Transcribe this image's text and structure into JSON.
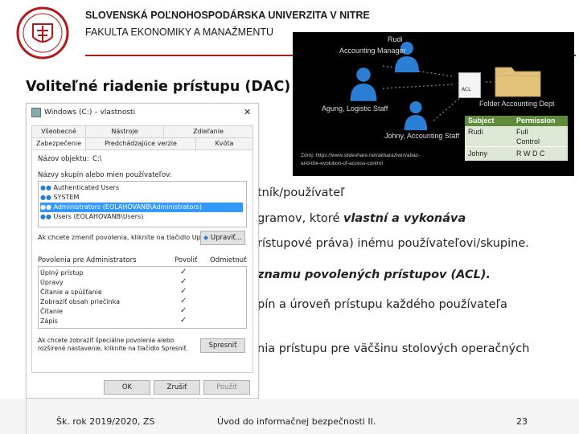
{
  "header": {
    "university": "SLOVENSKÁ POĽNOHOSPODÁRSKA UNIVERZITA V NITRE",
    "faculty": "FAKULTA EKONOMIKY A MANAŽMENTU"
  },
  "slide": {
    "title": "Voliteľné riadenie prístupu (DAC)",
    "lines": [
      {
        "text": "tník/používateľ"
      },
      {
        "text_a": "gramov, ktoré ",
        "text_b": "vlastní a vykonáva"
      },
      {
        "text": "rístupové práva) inému používateľovi/skupine."
      },
      {
        "text_a": "znamu povolených prístupov (ACL)",
        "text_b": "."
      },
      {
        "text": "pín a úroveň prístupu každého používateľa"
      },
      {
        "text": "nia prístupu pre väčšinu stolových operačných"
      }
    ]
  },
  "dac_image": {
    "people": [
      "Rudi",
      "Accounting Manager",
      "Agung, Logistic Staff",
      "Johny, Accounting Staff"
    ],
    "acl_label": "ACL",
    "folder_label": "Folder Accounting Dept",
    "table_headers": [
      "Subject",
      "Permission"
    ],
    "table_rows": [
      [
        "Rudi",
        "Full"
      ],
      [
        "",
        "Control"
      ],
      [
        "Johny",
        "R W D C"
      ]
    ],
    "source": "Zdroj: https://www.slideshare.net/akbaraziwin/abac-",
    "source2": "and-the-evolution-of-access-control"
  },
  "dialog": {
    "title": "Windows (C:) – vlastnosti",
    "close": "✕",
    "tabs_row1": [
      "Všeobecné",
      "Nástroje",
      "Zdieľanie"
    ],
    "tabs_row2": [
      "Zabezpečenie",
      "Predchádzajúce verzie",
      "Kvóta"
    ],
    "object_name_label": "Názov objektu:",
    "object_name_value": "C:\\",
    "groups_label": "Názvy skupín alebo mien používateľov:",
    "groups": [
      "Authenticated Users",
      "SYSTEM",
      "Administrators (EOLAHOVANB\\Administrators)",
      "Users (EOLAHOVANB\\Users)"
    ],
    "change_hint": "Ak chcete zmeniť povolenia, kliknite na tlačidlo Upr.",
    "edit_button": "Upraviť...",
    "permissions_for": "Povolenia pre Administrators",
    "allow": "Povoliť",
    "deny": "Odmietnuť",
    "permissions": [
      "Úplný prístup",
      "Úpravy",
      "Čítanie a spúšťanie",
      "Zobraziť obsah priečinka",
      "Čítanie",
      "Zápis"
    ],
    "check": "✓",
    "special_hint_1": "Ak chcete zobraziť špeciálne povolenia alebo",
    "special_hint_2": "rozšírené nastavenie, kliknite na tlačidlo Spresniť.",
    "advanced_button": "Spresniť",
    "ok": "OK",
    "cancel": "Zrušiť",
    "apply": "Použiť"
  },
  "footer": {
    "year": "Šk. rok 2019/2020, ZS",
    "course": "Úvod do informačnej bezpečnosti II.",
    "page": "23"
  },
  "colors": {
    "accent_red": "#b01a1a",
    "selection_blue": "#3399ff",
    "table_green": "#5e8c3a"
  }
}
